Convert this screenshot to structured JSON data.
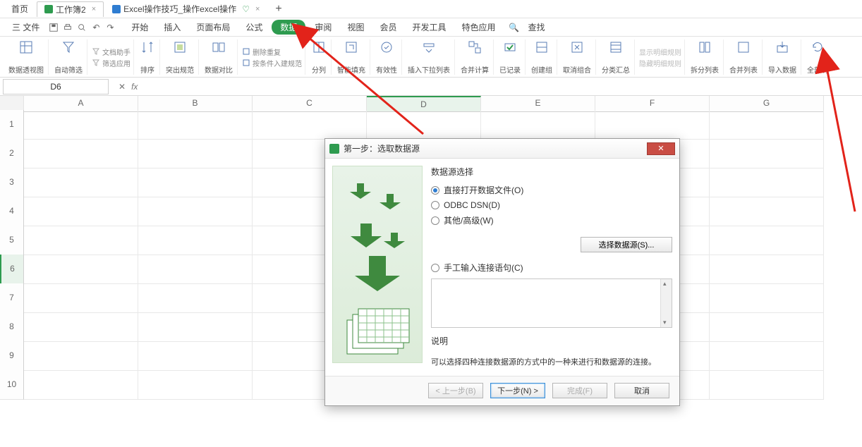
{
  "tabbar": {
    "tab0": "首页",
    "tab1": "工作簿2",
    "tab2": "Excel操作技巧_操作excel操作",
    "add": "+"
  },
  "menu": {
    "file": "三 文件",
    "items": [
      "开始",
      "插入",
      "页面布局",
      "公式",
      "数据",
      "审阅",
      "视图",
      "会员",
      "开发工具",
      "特色应用",
      "查找"
    ],
    "active_index": 4
  },
  "toolbar": {
    "g0": "数据透视图",
    "g1": "自动筛选",
    "g1a": "文档助手",
    "g1b": "筛选应用",
    "g2": "排序",
    "g3": "突出规范",
    "g4": "数据对比",
    "g5a": "删除重复",
    "g5b": "按条件入建规范",
    "g6": "分列",
    "g7": "智能填充",
    "g8": "有效性",
    "g9": "插入下拉列表",
    "g10": "合并计算",
    "g11": "已记录",
    "g12": "创建组",
    "g13": "取消组合",
    "g14": "分类汇总",
    "g15a": "显示明细规则",
    "g15b": "隐藏明细规则",
    "g16": "拆分列表",
    "g17": "合并列表",
    "g18": "导入数据",
    "g19": "全部刷"
  },
  "formula_bar": {
    "name_box": "D6",
    "fx": "fx"
  },
  "columns": [
    "A",
    "B",
    "C",
    "D",
    "E",
    "F",
    "G"
  ],
  "rows": [
    "1",
    "2",
    "3",
    "4",
    "5",
    "6",
    "7",
    "8",
    "9",
    "10"
  ],
  "active_cell": {
    "col": "D",
    "row": "6"
  },
  "dialog": {
    "title": "第一步：选取数据源",
    "src_label": "数据源选择",
    "opt1": "直接打开数据文件(O)",
    "opt2": "ODBC DSN(D)",
    "opt3": "其他/高级(W)",
    "select_src_btn": "选择数据源(S)...",
    "manual_label": "手工输入连接语句(C)",
    "desc_label": "说明",
    "desc_text": "可以选择四种连接数据源的方式中的一种来进行和数据源的连接。",
    "btn_prev": "< 上一步(B)",
    "btn_next": "下一步(N) >",
    "btn_finish": "完成(F)",
    "btn_cancel": "取消"
  }
}
